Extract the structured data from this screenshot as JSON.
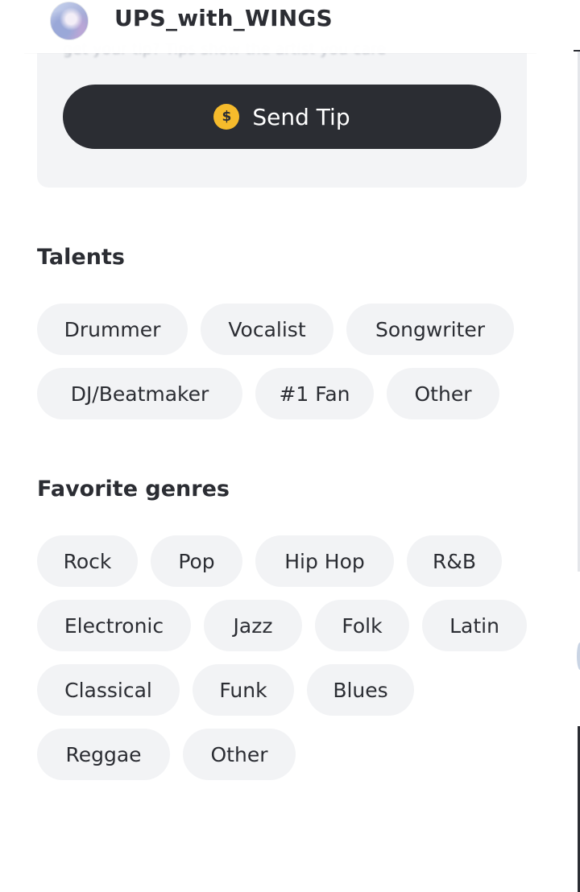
{
  "header": {
    "username": "UPS_with_WINGS",
    "avatar_icon": "avatar-image"
  },
  "tip_card": {
    "faded_text": "get your tip? Tips show the artist you care",
    "send_tip_label": "Send Tip",
    "coin_symbol": "$",
    "coin_color": "#f6bb2c",
    "button_color": "#2b2d33"
  },
  "talents": {
    "title": "Talents",
    "items": [
      "Drummer",
      "Vocalist",
      "Songwriter",
      "DJ/Beatmaker",
      "#1 Fan",
      "Other"
    ]
  },
  "genres": {
    "title": "Favorite genres",
    "items": [
      "Rock",
      "Pop",
      "Hip Hop",
      "R&B",
      "Electronic",
      "Jazz",
      "Folk",
      "Latin",
      "Classical",
      "Funk",
      "Blues",
      "Reggae",
      "Other"
    ]
  }
}
